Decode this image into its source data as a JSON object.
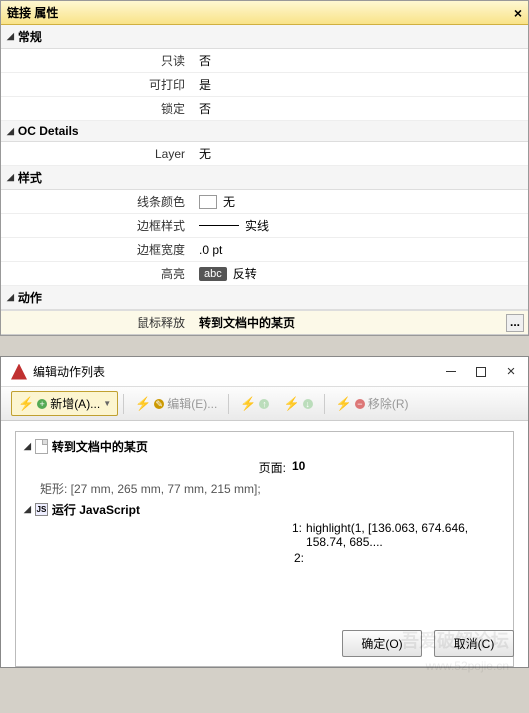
{
  "propsPanel": {
    "title": "链接 属性",
    "sections": {
      "general": {
        "header": "常规"
      },
      "oc": {
        "header": "OC Details"
      },
      "style": {
        "header": "样式"
      },
      "action": {
        "header": "动作"
      }
    },
    "rows": {
      "readonly": {
        "label": "只读",
        "value": "否"
      },
      "printable": {
        "label": "可打印",
        "value": "是"
      },
      "locked": {
        "label": "锁定",
        "value": "否"
      },
      "layer": {
        "label": "Layer",
        "value": "无"
      },
      "lineColor": {
        "label": "线条颜色",
        "value": "无"
      },
      "borderStyle": {
        "label": "边框样式",
        "value": "实线"
      },
      "borderWidth": {
        "label": "边框宽度",
        "value": ".0 pt"
      },
      "highlight": {
        "label": "高亮",
        "badge": "abc",
        "value": "反转"
      },
      "mouseUp": {
        "label": "鼠标释放",
        "value": "转到文档中的某页"
      }
    },
    "ellipsis": "..."
  },
  "dialog": {
    "title": "编辑动作列表",
    "toolbar": {
      "add": "新增(A)...",
      "edit": "编辑(E)...",
      "remove": "移除(R)"
    },
    "tree": {
      "goto": {
        "label": "转到文档中的某页",
        "pageLabel": "页面:",
        "pageValue": "10",
        "rect": "矩形: [27 mm, 265 mm, 77 mm, 215 mm];"
      },
      "js": {
        "label": "运行 JavaScript",
        "lines": [
          {
            "n": "1:",
            "code": "highlight(1, [136.063, 674.646, 158.74, 685...."
          },
          {
            "n": "2:",
            "code": ""
          }
        ]
      }
    },
    "buttons": {
      "ok": "确定(O)",
      "cancel": "取消(C)"
    }
  },
  "watermark": {
    "line1": "吾爱破解论坛",
    "line2": "www.52pojie.cn"
  }
}
